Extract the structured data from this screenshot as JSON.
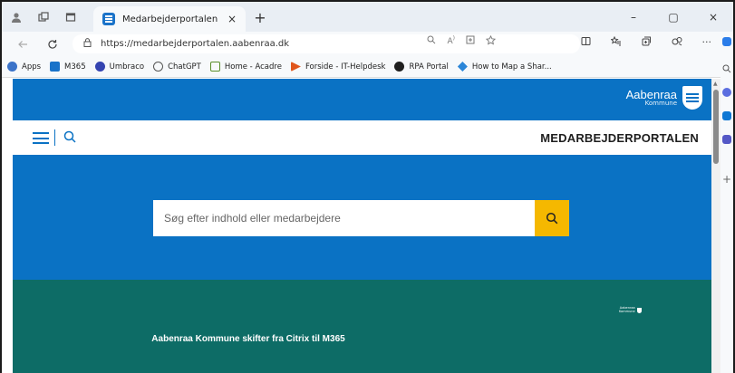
{
  "browser": {
    "tab_title": "Medarbejderportalen",
    "tab_close": "×",
    "new_tab": "+",
    "url": "https://medarbejderportalen.aabenraa.dk",
    "window_controls": [
      "–",
      "▢",
      "×"
    ]
  },
  "bookmarks": [
    {
      "label": "Apps",
      "icon": "apps-icon",
      "color": "#3b73c9"
    },
    {
      "label": "M365",
      "icon": "m365-icon",
      "color": "#1a73c9"
    },
    {
      "label": "Umbraco",
      "icon": "umbraco-icon",
      "color": "#3544b1"
    },
    {
      "label": "ChatGPT",
      "icon": "chatgpt-icon",
      "color": "#555555"
    },
    {
      "label": "Home - Acadre",
      "icon": "acadre-icon",
      "color": "#5a8f2a"
    },
    {
      "label": "Forside - IT-Helpdesk",
      "icon": "helpdesk-icon",
      "color": "#e0561c"
    },
    {
      "label": "RPA Portal",
      "icon": "rpa-icon",
      "color": "#1f1f1f"
    },
    {
      "label": "How to Map a Shar...",
      "icon": "sharepoint-map-icon",
      "color": "#2b86d8"
    }
  ],
  "site": {
    "brand_name": "Aabenraa",
    "brand_sub": "Kommune",
    "portal_title": "MEDARBEJDERPORTALEN",
    "search_placeholder": "Søg efter indhold eller medarbejdere",
    "headline": "Aabenraa Kommune skifter fra Citrix til M365",
    "colors": {
      "primary_blue": "#0a72c4",
      "accent_yellow": "#f5b800",
      "news_teal": "#0d6c66"
    }
  }
}
